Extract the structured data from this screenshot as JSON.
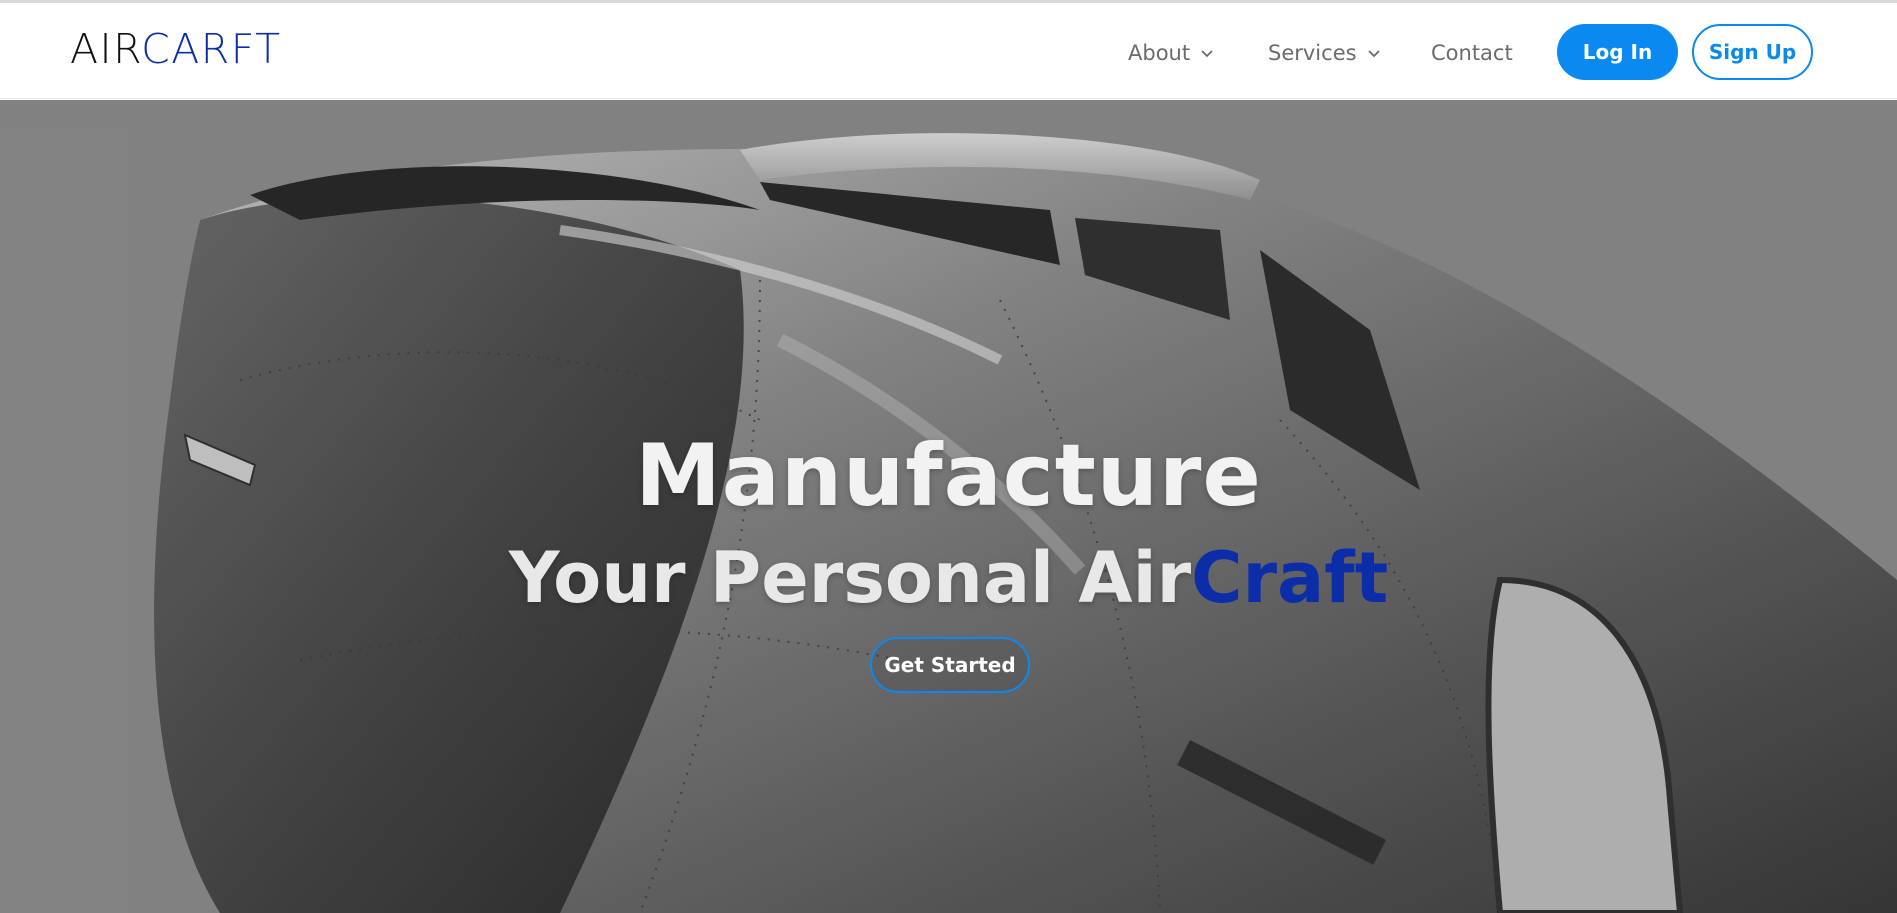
{
  "brand": {
    "logo_part_a": "AIR",
    "logo_part_b": "CARFT",
    "logo_color_a": "#111111",
    "logo_color_b": "#0b2ea8"
  },
  "nav": {
    "about_label": "About",
    "services_label": "Services",
    "contact_label": "Contact",
    "about_icon": "chevron-down-icon",
    "services_icon": "chevron-down-icon"
  },
  "auth": {
    "login_label": "Log In",
    "signup_label": "Sign Up",
    "accent_color": "#0a8af0"
  },
  "hero": {
    "title": "Manufacture",
    "subtitle_prefix": "Your Personal Air",
    "subtitle_accent": "Craft",
    "accent_color": "#0b2ea8",
    "cta_label": "Get Started",
    "background_image": "black-and-white aircraft nose and cockpit"
  }
}
